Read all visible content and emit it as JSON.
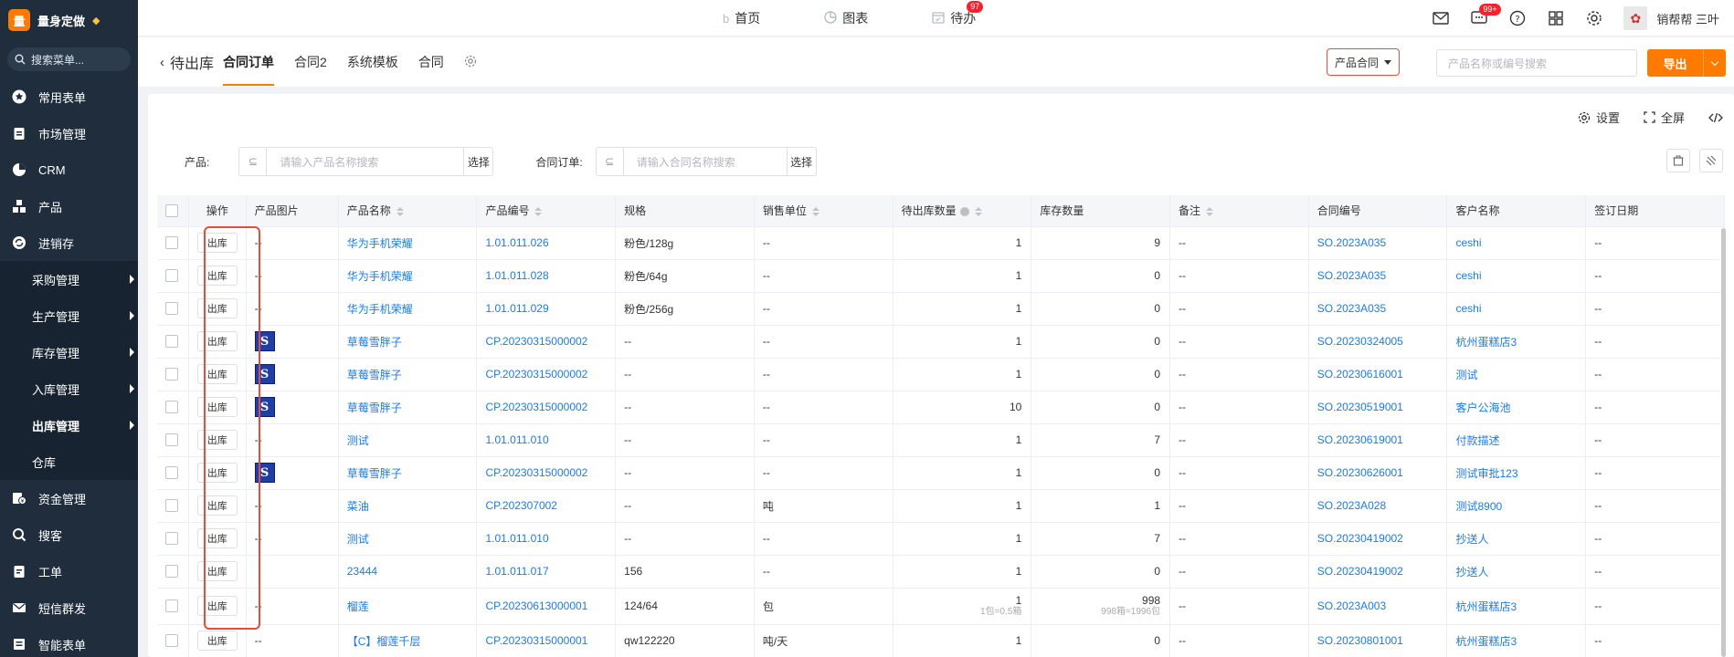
{
  "app": {
    "logo_char": "量",
    "title": "量身定做",
    "search_menu": "搜索菜单..."
  },
  "sidebar": {
    "items": [
      {
        "label": "常用表单",
        "icon": "star-icon"
      },
      {
        "label": "市场管理",
        "icon": "clipboard-icon"
      },
      {
        "label": "CRM",
        "icon": "pie-icon"
      },
      {
        "label": "产品",
        "icon": "grid-icon"
      },
      {
        "label": "进销存",
        "icon": "cycle-icon"
      }
    ],
    "sub_items": [
      {
        "label": "采购管理",
        "arrow": true
      },
      {
        "label": "生产管理",
        "arrow": true
      },
      {
        "label": "库存管理",
        "arrow": true
      },
      {
        "label": "入库管理",
        "arrow": true
      },
      {
        "label": "出库管理",
        "arrow": true,
        "active": true
      },
      {
        "label": "仓库",
        "arrow": false
      }
    ],
    "items_after": [
      {
        "label": "资金管理",
        "icon": "money-icon"
      },
      {
        "label": "搜客",
        "icon": "search-icon"
      },
      {
        "label": "工单",
        "icon": "ticket-icon"
      },
      {
        "label": "短信群发",
        "icon": "mail-icon"
      },
      {
        "label": "智能表单",
        "icon": "form-icon"
      }
    ]
  },
  "topnav": {
    "home": "首页",
    "chart": "图表",
    "todo": "待办",
    "todo_badge": "97"
  },
  "topright": {
    "msg_badge": "99+",
    "user": "销帮帮 三叶"
  },
  "tabs": {
    "back": "待出库",
    "active": "合同订单",
    "tab2": "合同2",
    "tab3": "系统模板",
    "tab4": "合同"
  },
  "toolbar": {
    "contract_select": "产品合同",
    "search_placeholder": "产品名称或编号搜索",
    "export_label": "导出"
  },
  "panel": {
    "settings": "设置",
    "fullscreen": "全屏"
  },
  "filters": {
    "product_label": "产品:",
    "product_placeholder": "请输入产品名称搜索",
    "product_btn": "选择",
    "order_label": "合同订单:",
    "order_placeholder": "请输入合同名称搜索",
    "order_btn": "选择"
  },
  "table": {
    "headers": [
      "操作",
      "产品图片",
      "产品名称",
      "产品编号",
      "规格",
      "销售单位",
      "待出库数量",
      "库存数量",
      "备注",
      "合同编号",
      "客户名称",
      "签订日期"
    ],
    "op_label": "出库",
    "rows": [
      {
        "img": "--",
        "name": "华为手机荣耀",
        "code": "1.01.011.026",
        "spec": "粉色/128g",
        "unit": "--",
        "pending": "1",
        "pending_sub": "",
        "stock": "9",
        "stock_sub": "",
        "note": "--",
        "contract": "SO.2023A035",
        "customer": "ceshi",
        "date": "--"
      },
      {
        "img": "--",
        "name": "华为手机荣耀",
        "code": "1.01.011.028",
        "spec": "粉色/64g",
        "unit": "--",
        "pending": "1",
        "pending_sub": "",
        "stock": "0",
        "stock_sub": "",
        "note": "--",
        "contract": "SO.2023A035",
        "customer": "ceshi",
        "date": "--"
      },
      {
        "img": "--",
        "name": "华为手机荣耀",
        "code": "1.01.011.029",
        "spec": "粉色/256g",
        "unit": "--",
        "pending": "1",
        "pending_sub": "",
        "stock": "0",
        "stock_sub": "",
        "note": "--",
        "contract": "SO.2023A035",
        "customer": "ceshi",
        "date": "--"
      },
      {
        "img": "S",
        "name": "草莓雪胖子",
        "code": "CP.20230315000002",
        "spec": "--",
        "unit": "--",
        "pending": "1",
        "pending_sub": "",
        "stock": "0",
        "stock_sub": "",
        "note": "--",
        "contract": "SO.20230324005",
        "customer": "杭州蛋糕店3",
        "date": "--"
      },
      {
        "img": "S",
        "name": "草莓雪胖子",
        "code": "CP.20230315000002",
        "spec": "--",
        "unit": "--",
        "pending": "1",
        "pending_sub": "",
        "stock": "0",
        "stock_sub": "",
        "note": "--",
        "contract": "SO.20230616001",
        "customer": "测试",
        "date": "--"
      },
      {
        "img": "S",
        "name": "草莓雪胖子",
        "code": "CP.20230315000002",
        "spec": "--",
        "unit": "--",
        "pending": "10",
        "pending_sub": "",
        "stock": "0",
        "stock_sub": "",
        "note": "--",
        "contract": "SO.20230519001",
        "customer": "客户公海池",
        "date": "--"
      },
      {
        "img": "--",
        "name": "测试",
        "code": "1.01.011.010",
        "spec": "--",
        "unit": "--",
        "pending": "1",
        "pending_sub": "",
        "stock": "7",
        "stock_sub": "",
        "note": "--",
        "contract": "SO.20230619001",
        "customer": "付款描述",
        "date": "--"
      },
      {
        "img": "S",
        "name": "草莓雪胖子",
        "code": "CP.20230315000002",
        "spec": "--",
        "unit": "--",
        "pending": "1",
        "pending_sub": "",
        "stock": "0",
        "stock_sub": "",
        "note": "--",
        "contract": "SO.20230626001",
        "customer": "测试审批123",
        "date": "--"
      },
      {
        "img": "--",
        "name": "菜油",
        "code": "CP.202307002",
        "spec": "--",
        "unit": "吨",
        "pending": "1",
        "pending_sub": "",
        "stock": "1",
        "stock_sub": "",
        "note": "--",
        "contract": "SO.2023A028",
        "customer": "测试8900",
        "date": "--"
      },
      {
        "img": "--",
        "name": "测试",
        "code": "1.01.011.010",
        "spec": "--",
        "unit": "--",
        "pending": "1",
        "pending_sub": "",
        "stock": "7",
        "stock_sub": "",
        "note": "--",
        "contract": "SO.20230419002",
        "customer": "抄送人",
        "date": "--"
      },
      {
        "img": "",
        "name": "23444",
        "code": "1.01.011.017",
        "spec": "156",
        "unit": "--",
        "pending": "1",
        "pending_sub": "",
        "stock": "0",
        "stock_sub": "",
        "note": "--",
        "contract": "SO.20230419002",
        "customer": "抄送人",
        "date": "--"
      },
      {
        "img": "--",
        "name": "榴莲",
        "code": "CP.20230613000001",
        "spec": "124/64",
        "unit": "包",
        "pending": "1",
        "pending_sub": "1包=0.5箱",
        "stock": "998",
        "stock_sub": "998箱=1996包",
        "note": "--",
        "contract": "SO.2023A003",
        "customer": "杭州蛋糕店3",
        "date": "--"
      },
      {
        "img": "--",
        "name": "【C】榴莲千层",
        "code": "CP.20230315000001",
        "spec": "qw122220",
        "unit": "吨/天",
        "pending": "1",
        "pending_sub": "",
        "stock": "0",
        "stock_sub": "",
        "note": "--",
        "contract": "SO.20230801001",
        "customer": "杭州蛋糕店3",
        "date": "--"
      }
    ]
  },
  "colors": {
    "accent": "#ff7a00",
    "sidebar_bg": "#1f2d3d",
    "link": "#1a7be8",
    "highlight": "#e74c3c"
  }
}
